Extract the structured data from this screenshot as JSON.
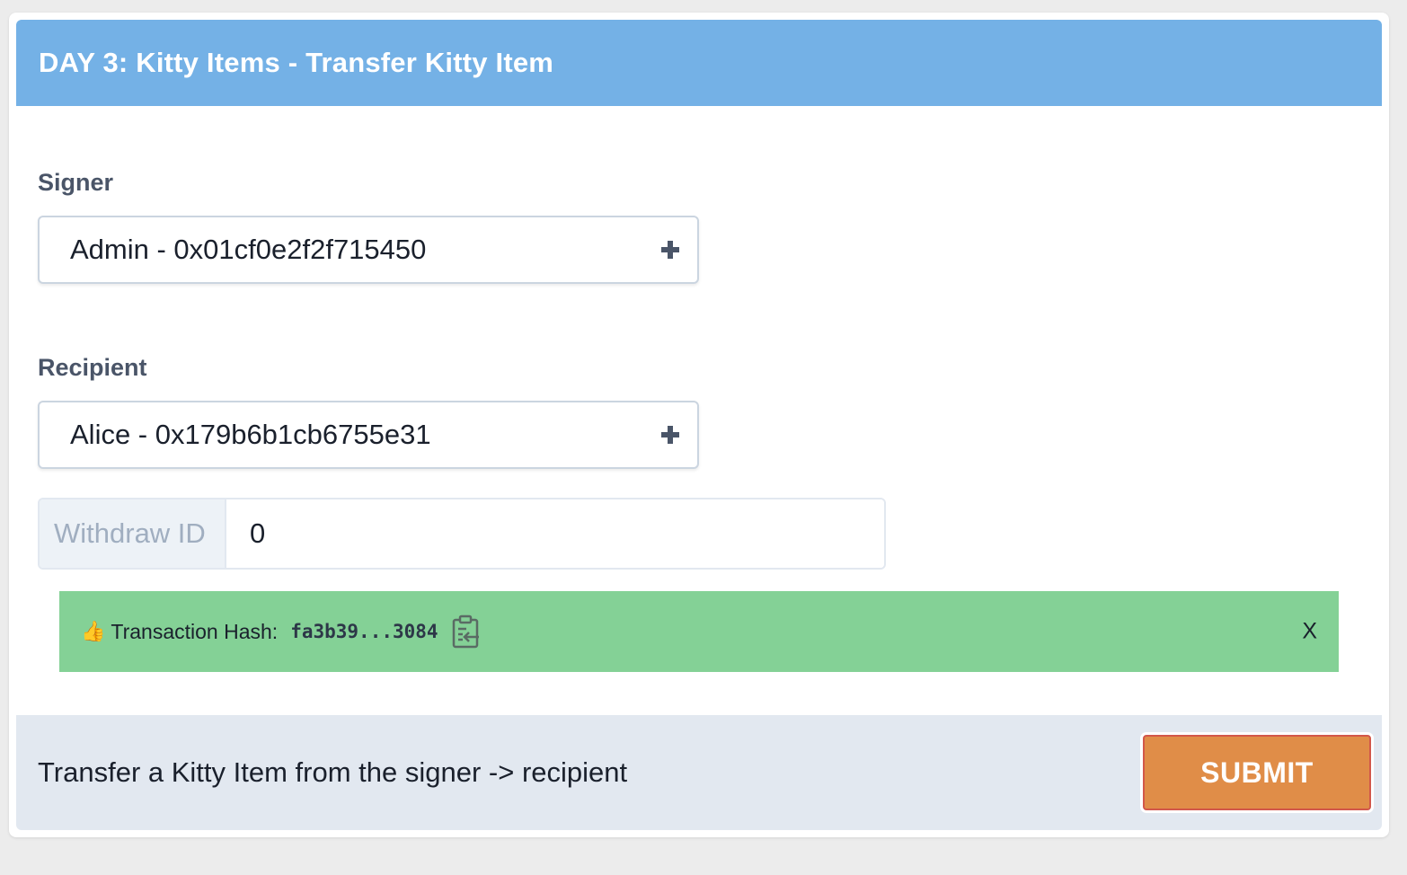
{
  "card": {
    "title": "DAY 3: Kitty Items - Transfer Kitty Item"
  },
  "signer": {
    "label": "Signer",
    "value": "Admin - 0x01cf0e2f2f715450"
  },
  "recipient": {
    "label": "Recipient",
    "value": "Alice - 0x179b6b1cb6755e31"
  },
  "withdraw": {
    "label": "Withdraw ID",
    "value": "0"
  },
  "alert": {
    "icon": "thumbs-up-icon",
    "emoji": "👍",
    "label": "Transaction Hash:",
    "hash": "fa3b39...3084",
    "close_label": "X",
    "color": "#84d196"
  },
  "footer": {
    "description": "Transfer a Kitty Item from the signer -> recipient",
    "submit_label": "SUBMIT",
    "submit_color": "#e08d48"
  },
  "colors": {
    "header": "#74b1e6",
    "footer_bg": "#e2e8f0"
  }
}
